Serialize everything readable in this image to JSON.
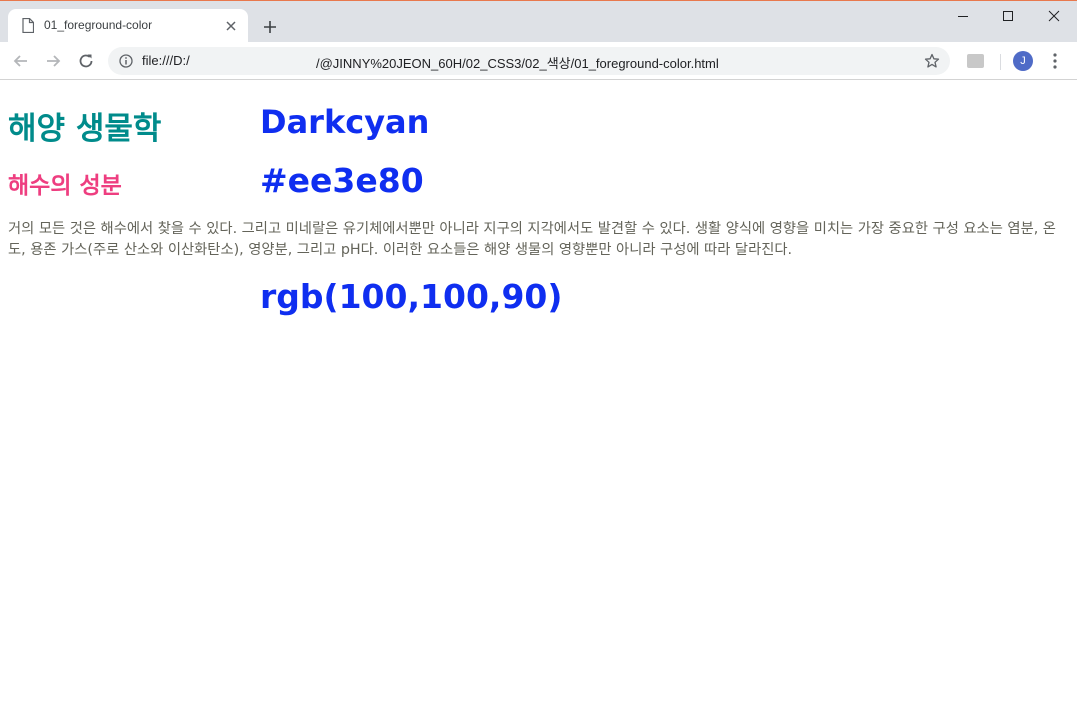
{
  "browser": {
    "tab_title": "01_foreground-color",
    "url_scheme": "file:///D:/",
    "url_path": "/@JINNY%20JEON_60H/02_CSS3/02_색상/01_foreground-color.html",
    "avatar_letter": "J",
    "accent_color": "#e8784d"
  },
  "page": {
    "heading1": "해양 생물학",
    "heading1_color": "#008b8b",
    "heading2": "해수의 성분",
    "heading2_color": "#ee3e80",
    "paragraph": "거의 모든 것은 해수에서 찾을 수 있다. 그리고 미네랄은 유기체에서뿐만 아니라 지구의 지각에서도 발견할 수 있다. 생활 양식에 영향을 미치는 가장 중요한 구성 요소는 염분, 온도, 용존 가스(주로 산소와 이산화탄소), 영양분, 그리고 pH다. 이러한 요소들은 해양 생물의 영향뿐만 아니라 구성에 따라 달라진다.",
    "paragraph_color": "#64645a",
    "label1": "Darkcyan",
    "label2": "#ee3e80",
    "label3": "rgb(100,100,90)",
    "label_color": "#0f2ef0"
  },
  "icons": {
    "tab": "page-icon",
    "close": "close-icon",
    "newtab": "plus-icon",
    "back": "arrow-left-icon",
    "forward": "arrow-right-icon",
    "reload": "reload-icon",
    "info": "info-icon",
    "bookmark": "star-icon",
    "menu": "kebab-menu-icon"
  }
}
